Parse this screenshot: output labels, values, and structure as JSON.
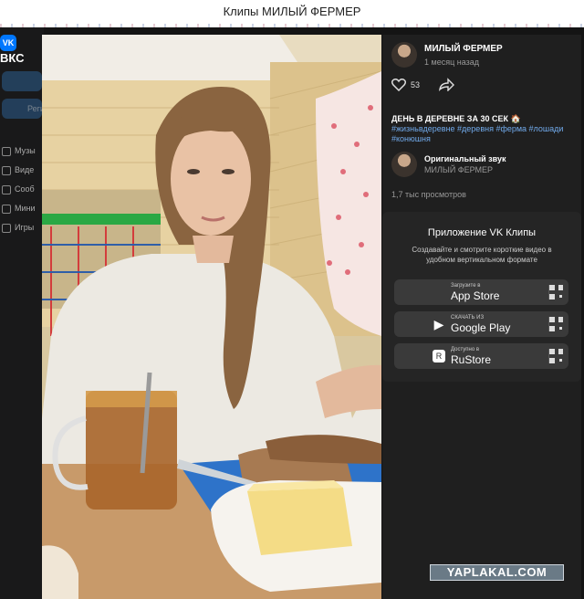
{
  "window": {
    "title": "Клипы МИЛЫЙ ФЕРМЕР"
  },
  "vk_sidebar": {
    "logo": "ВКС",
    "menu": [
      "Музы",
      "Виде",
      "Сооб",
      "Мини",
      "Игры"
    ],
    "reg_button": "Регис"
  },
  "clip": {
    "author": "МИЛЫЙ ФЕРМЕР",
    "posted": "1 месяц назад",
    "likes": "53",
    "caption": "ДЕНЬ В ДЕРЕВНЕ ЗА 30 СЕК",
    "caption_emoji": "🏠",
    "hashtags": "#жизньвдеревне #деревня #ферма #лошади #конюшня",
    "sound_title": "Оригинальный звук",
    "sound_author": "МИЛЫЙ ФЕРМЕР",
    "views": "1,7 тыс просмотров"
  },
  "app_promo": {
    "title": "Приложение VK Клипы",
    "description": "Создавайте и смотрите короткие видео в удобном вертикальном формате",
    "stores": [
      {
        "small": "Загрузите в",
        "name": "App Store",
        "icon": "apple-icon"
      },
      {
        "small": "СКАЧАТЬ ИЗ",
        "name": "Google Play",
        "icon": "google-play-icon"
      },
      {
        "small": "Доступно в",
        "name": "RuStore",
        "icon": "rustore-icon"
      }
    ]
  },
  "watermark": "YAPLAKAL.COM",
  "colors": {
    "panel": "#1f1f1f",
    "link": "#71aaeb",
    "vk_blue": "#0077ff"
  }
}
